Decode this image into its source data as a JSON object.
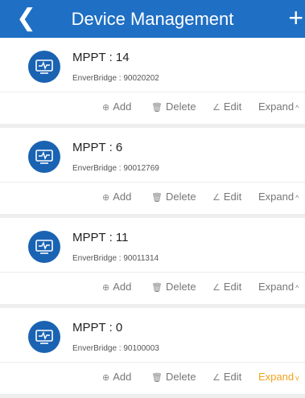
{
  "header": {
    "back_icon": "chevron-left-icon",
    "title": "Device Management",
    "add_icon": "plus-icon"
  },
  "actions": {
    "add": "Add",
    "delete": "Delete",
    "edit": "Edit",
    "expand": "Expand"
  },
  "devices": [
    {
      "name": "MPPT : 14",
      "serial": "EnverBridge : 90020202",
      "expanded": false
    },
    {
      "name": "MPPT : 6",
      "serial": "EnverBridge : 90012769",
      "expanded": false
    },
    {
      "name": "MPPT : 11",
      "serial": "EnverBridge : 90011314",
      "expanded": false
    },
    {
      "name": "MPPT : 0",
      "serial": "EnverBridge : 90100003",
      "expanded": true
    }
  ],
  "colors": {
    "header_bg": "#1f6fc4",
    "icon_bg": "#1a63b3",
    "expand_active": "#f2a31b"
  }
}
